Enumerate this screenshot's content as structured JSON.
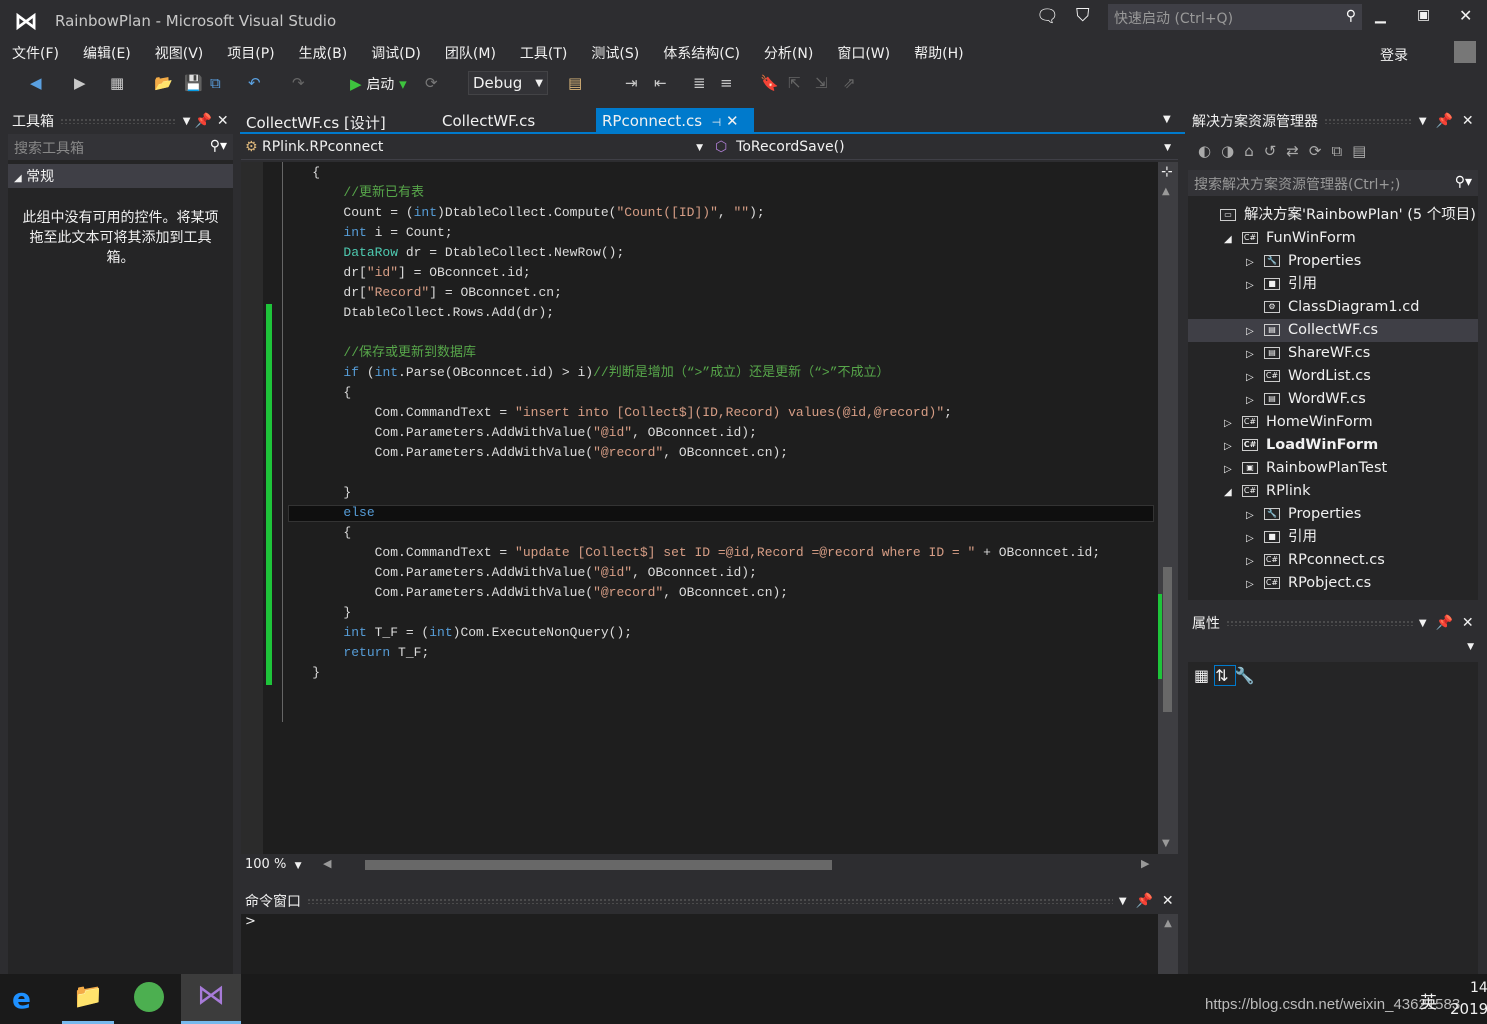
{
  "window": {
    "title": "RainbowPlan - Microsoft Visual Studio",
    "quick_launch": "快速启动 (Ctrl+Q)",
    "login": "登录"
  },
  "menu": [
    "文件(F)",
    "编辑(E)",
    "视图(V)",
    "项目(P)",
    "生成(B)",
    "调试(D)",
    "团队(M)",
    "工具(T)",
    "测试(S)",
    "体系结构(C)",
    "分析(N)",
    "窗口(W)",
    "帮助(H)"
  ],
  "toolbar": {
    "start": "启动",
    "config": "Debug"
  },
  "toolbox": {
    "title": "工具箱",
    "search_placeholder": "搜索工具箱",
    "group": "常规",
    "empty_text": "此组中没有可用的控件。将某项拖至此文本可将其添加到工具箱。"
  },
  "tabs": [
    {
      "label": "CollectWF.cs [设计]"
    },
    {
      "label": "CollectWF.cs"
    },
    {
      "label": "RPconnect.cs",
      "active": true
    }
  ],
  "nav": {
    "class": "RPlink.RPconnect",
    "method": "ToRecordSave()"
  },
  "code": [
    [
      [
        "    {",
        ""
      ]
    ],
    [
      [
        "        //更新已有表",
        "cm"
      ]
    ],
    [
      [
        "        Count = (",
        ""
      ],
      [
        "int",
        "kw"
      ],
      [
        ")DtableCollect.Compute(",
        ""
      ],
      [
        "\"Count([ID])\"",
        "st"
      ],
      [
        ", ",
        ""
      ],
      [
        "\"\"",
        "st"
      ],
      [
        ");",
        ""
      ]
    ],
    [
      [
        "        ",
        ""
      ],
      [
        "int",
        "kw"
      ],
      [
        " i = Count;",
        ""
      ]
    ],
    [
      [
        "        ",
        ""
      ],
      [
        "DataRow",
        "ty"
      ],
      [
        " dr = DtableCollect.NewRow();",
        ""
      ]
    ],
    [
      [
        "        dr[",
        ""
      ],
      [
        "\"id\"",
        "st"
      ],
      [
        "] = OBconncet.id;",
        ""
      ]
    ],
    [
      [
        "        dr[",
        ""
      ],
      [
        "\"Record\"",
        "st"
      ],
      [
        "] = OBconncet.cn;",
        ""
      ]
    ],
    [
      [
        "        DtableCollect.Rows.Add(dr);",
        ""
      ]
    ],
    [],
    [
      [
        "        //保存或更新到数据库",
        "cm"
      ]
    ],
    [
      [
        "        ",
        ""
      ],
      [
        "if",
        "kw"
      ],
      [
        " (",
        ""
      ],
      [
        "int",
        "kw"
      ],
      [
        ".Parse(OBconncet.id) > i)",
        ""
      ],
      [
        "//判断是增加（“>”成立）还是更新（“>”不成立）",
        "cm"
      ]
    ],
    [
      [
        "        {",
        ""
      ]
    ],
    [
      [
        "            Com.CommandText = ",
        ""
      ],
      [
        "\"insert into [Collect$](ID,Record) values(@id,@record)\"",
        "st"
      ],
      [
        ";",
        ""
      ]
    ],
    [
      [
        "            Com.Parameters.AddWithValue(",
        ""
      ],
      [
        "\"@id\"",
        "st"
      ],
      [
        ", OBconncet.id);",
        ""
      ]
    ],
    [
      [
        "            Com.Parameters.AddWithValue(",
        ""
      ],
      [
        "\"@record\"",
        "st"
      ],
      [
        ", OBconncet.cn);",
        ""
      ]
    ],
    [],
    [
      [
        "        }",
        ""
      ]
    ],
    [
      [
        "        ",
        ""
      ],
      [
        "else",
        "kw"
      ]
    ],
    [
      [
        "        {",
        ""
      ]
    ],
    [
      [
        "            Com.CommandText = ",
        ""
      ],
      [
        "\"update [Collect$] set ID =@id,Record =@record where ID = \"",
        "st"
      ],
      [
        " + OBconncet.id;",
        ""
      ]
    ],
    [
      [
        "            Com.Parameters.AddWithValue(",
        ""
      ],
      [
        "\"@id\"",
        "st"
      ],
      [
        ", OBconncet.id);",
        ""
      ]
    ],
    [
      [
        "            Com.Parameters.AddWithValue(",
        ""
      ],
      [
        "\"@record\"",
        "st"
      ],
      [
        ", OBconncet.cn);",
        ""
      ]
    ],
    [
      [
        "        }",
        ""
      ]
    ],
    [
      [
        "        ",
        ""
      ],
      [
        "int",
        "kw"
      ],
      [
        " T_F = (",
        ""
      ],
      [
        "int",
        "kw"
      ],
      [
        ")Com.ExecuteNonQuery();",
        ""
      ]
    ],
    [
      [
        "        ",
        ""
      ],
      [
        "return",
        "kw"
      ],
      [
        " T_F;",
        ""
      ]
    ],
    [
      [
        "    }",
        ""
      ]
    ]
  ],
  "editor": {
    "zoom": "100 %"
  },
  "command_window": {
    "title": "命令窗口",
    "prompt": ">"
  },
  "solution": {
    "title": "解决方案资源管理器",
    "search_placeholder": "搜索解决方案资源管理器(Ctrl+;)",
    "items": [
      {
        "label": "解决方案'RainbowPlan' (5 个项目)",
        "level": 0,
        "icon": "solution-icon"
      },
      {
        "label": "FunWinForm",
        "level": 1,
        "icon": "csharp-project-icon",
        "expanded": true
      },
      {
        "label": "Properties",
        "level": 2,
        "icon": "wrench-icon"
      },
      {
        "label": "引用",
        "level": 2,
        "icon": "references-icon"
      },
      {
        "label": "ClassDiagram1.cd",
        "level": 2,
        "icon": "class-diagram-icon"
      },
      {
        "label": "CollectWF.cs",
        "level": 2,
        "icon": "form-icon",
        "selected": true
      },
      {
        "label": "ShareWF.cs",
        "level": 2,
        "icon": "form-icon"
      },
      {
        "label": "WordList.cs",
        "level": 2,
        "icon": "csharp-file-icon"
      },
      {
        "label": "WordWF.cs",
        "level": 2,
        "icon": "form-icon"
      },
      {
        "label": "HomeWinForm",
        "level": 1,
        "icon": "csharp-project-icon"
      },
      {
        "label": "LoadWinForm",
        "level": 1,
        "icon": "csharp-project-icon",
        "bold": true
      },
      {
        "label": "RainbowPlanTest",
        "level": 1,
        "icon": "test-project-icon"
      },
      {
        "label": "RPlink",
        "level": 1,
        "icon": "csharp-project-icon",
        "expanded": true
      },
      {
        "label": "Properties",
        "level": 2,
        "icon": "wrench-icon"
      },
      {
        "label": "引用",
        "level": 2,
        "icon": "references-icon"
      },
      {
        "label": "RPconnect.cs",
        "level": 2,
        "icon": "csharp-file-icon"
      },
      {
        "label": "RPobject.cs",
        "level": 2,
        "icon": "csharp-file-icon"
      }
    ]
  },
  "properties": {
    "title": "属性"
  },
  "taskbar": {
    "clock_time": "14",
    "clock_date": "2019/",
    "ime": "英",
    "watermark": "https://blog.csdn.net/weixin_43621583"
  },
  "colors": {
    "accent": "#007acc",
    "vs_purple": "#68217a",
    "change_bar": "#1ec43a"
  }
}
